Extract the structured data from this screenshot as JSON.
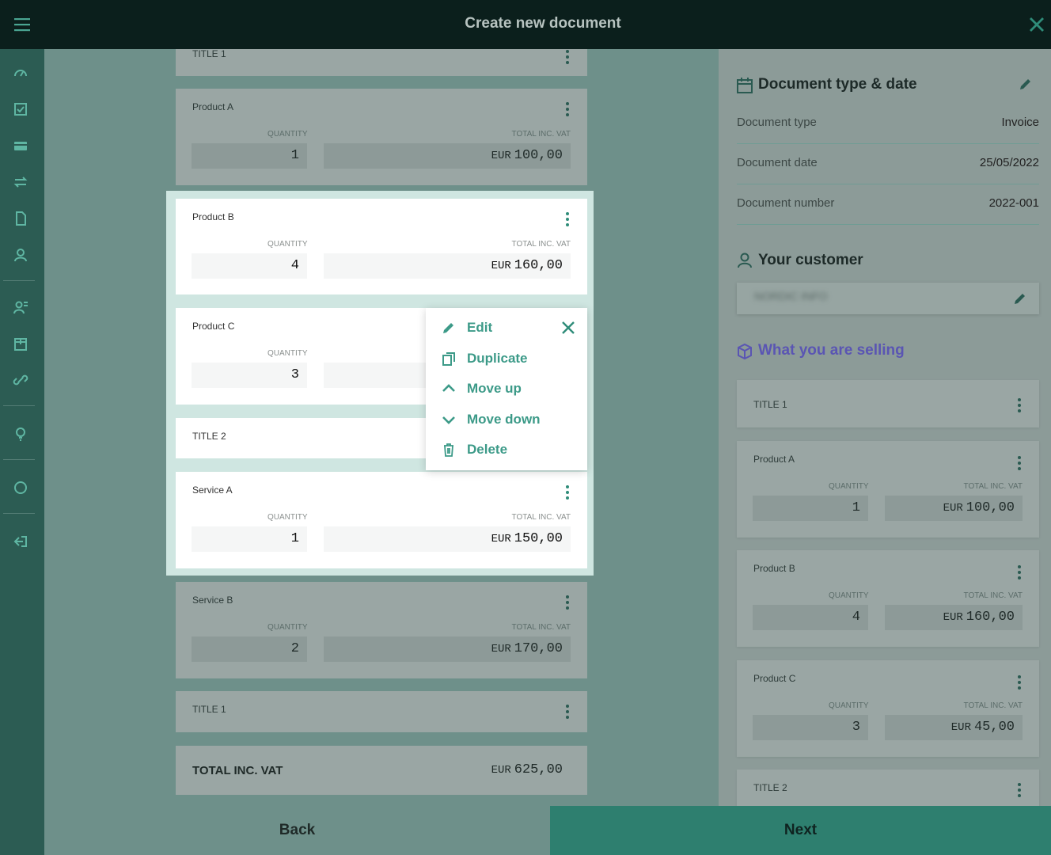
{
  "header": {
    "title": "Create new document"
  },
  "colors": {
    "accent": "#3c9a88",
    "brand_dark": "#0b1f1c",
    "sidebar": "#2c5c53",
    "selling": "#5a55b3"
  },
  "sidebar": {
    "icons": [
      "menu-icon",
      "dashboard-icon",
      "checklist-icon",
      "card-icon",
      "transfer-icon",
      "document-icon",
      "user-icon",
      "contacts-icon",
      "product-box-icon",
      "link-icon",
      "lightbulb-icon",
      "circle-icon",
      "logout-icon"
    ]
  },
  "labels": {
    "quantity": "QUANTITY",
    "total_inc_vat": "TOTAL INC. VAT",
    "currency": "EUR"
  },
  "items": {
    "title1_top": {
      "name": "TITLE 1"
    },
    "product_a": {
      "name": "Product A",
      "quantity": "1",
      "total": "100,00"
    },
    "product_b": {
      "name": "Product B",
      "quantity": "4",
      "total": "160,00"
    },
    "product_c": {
      "name": "Product C",
      "quantity": "3",
      "total": "45,00"
    },
    "title2": {
      "name": "TITLE 2"
    },
    "service_a": {
      "name": "Service A",
      "quantity": "1",
      "total": "150,00"
    },
    "service_b": {
      "name": "Service B",
      "quantity": "2",
      "total": "170,00"
    },
    "title1_bottom": {
      "name": "TITLE 1"
    }
  },
  "context_menu": {
    "edit": "Edit",
    "duplicate": "Duplicate",
    "move_up": "Move up",
    "move_down": "Move down",
    "delete": "Delete"
  },
  "total": {
    "label": "TOTAL INC. VAT",
    "currency": "EUR",
    "value": "625,00"
  },
  "right_panel": {
    "doc_section_title": "Document type & date",
    "doc_type_label": "Document type",
    "doc_type_value": "Invoice",
    "doc_date_label": "Document date",
    "doc_date_value": "25/05/2022",
    "doc_number_label": "Document number",
    "doc_number_value": "2022-001",
    "customer_title": "Your customer",
    "customer_name_blurred": "NORDIC INFO",
    "selling_title": "What you are selling"
  },
  "footer": {
    "back": "Back",
    "next": "Next"
  }
}
